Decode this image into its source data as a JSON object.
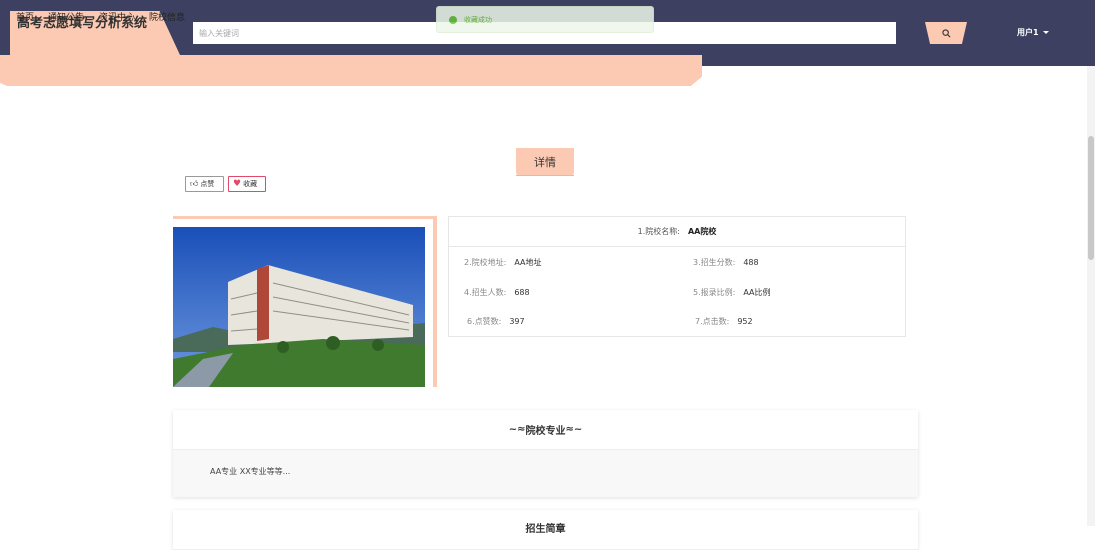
{
  "header": {
    "brand_title": "高考志愿填写分析系统",
    "search_placeholder": "输入关键词",
    "user_label": "用户1"
  },
  "toast": {
    "message": "收藏成功"
  },
  "nav": {
    "items": [
      "首页",
      "通知公告",
      "资讯中心",
      "院校信息"
    ]
  },
  "detail": {
    "tab_label": "详情",
    "like_button": "点赞",
    "favorite_button": "收藏"
  },
  "school": {
    "name_label": "1.院校名称:",
    "name_value": "AA院校",
    "fields": [
      {
        "label": "2.院校地址:",
        "value": "AA地址"
      },
      {
        "label": "3.招生分数:",
        "value": "488"
      },
      {
        "label": "4.招生人数:",
        "value": "688"
      },
      {
        "label": "5.报录比例:",
        "value": "AA比例"
      },
      {
        "label": "6.点赞数:",
        "value": "397"
      },
      {
        "label": "7.点击数:",
        "value": "952"
      }
    ]
  },
  "sections": {
    "majors_title": "院校专业",
    "majors_body": "AA专业 XX专业等等...",
    "next_title": "招生简章"
  },
  "colors": {
    "header_bg": "#3d4060",
    "accent": "#fcc9b3",
    "success": "#67c23a",
    "favorite": "#e04b6a"
  }
}
